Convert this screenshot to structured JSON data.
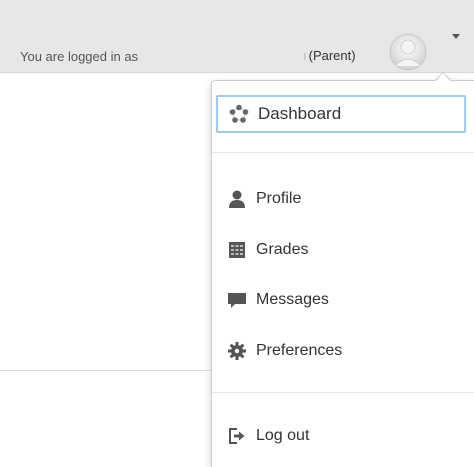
{
  "header": {
    "logged_in_text": "You are logged in as",
    "user_role": "(Parent)",
    "name_separator": "ı"
  },
  "menu": {
    "items": [
      {
        "label": "Dashboard",
        "icon": "dashboard-icon"
      },
      {
        "label": "Profile",
        "icon": "user-icon"
      },
      {
        "label": "Grades",
        "icon": "grades-table-icon"
      },
      {
        "label": "Messages",
        "icon": "speech-bubble-icon"
      },
      {
        "label": "Preferences",
        "icon": "gear-icon"
      },
      {
        "label": "Log out",
        "icon": "logout-icon"
      }
    ]
  },
  "colors": {
    "topbar_bg": "#e7e7e7",
    "focus_outline": "#9ecaed",
    "icon_gray": "#555555",
    "text": "#333333"
  }
}
